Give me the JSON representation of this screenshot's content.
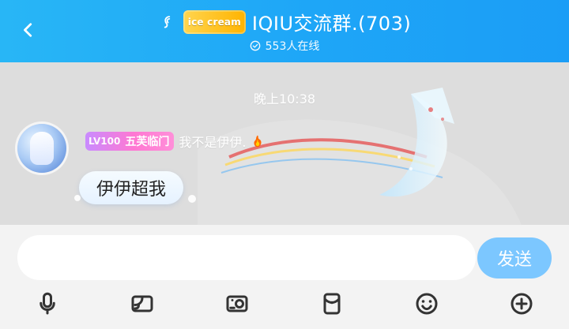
{
  "header": {
    "title": "IQIU交流群.(703)",
    "online_text": "553人在线",
    "group_badge_text": "ice cream",
    "icons": {
      "back": "back-chevron-icon",
      "listen": "ear-icon",
      "online_status": "check-circle-icon"
    },
    "colors": {
      "header_gradient_start": "#28b6f6",
      "header_gradient_end": "#1b9df6"
    }
  },
  "chat": {
    "timestamp": "晚上10:38",
    "messages": [
      {
        "sender_level": "LV100",
        "sender_title": "五芙临门",
        "sender_name": "我不是伊伊.",
        "text": "伊伊超我",
        "icons": {
          "avatar": "avatar-image",
          "sender_badge": "flame-icon"
        }
      }
    ]
  },
  "input": {
    "placeholder": "",
    "send_label": "发送"
  },
  "toolbar": {
    "items": [
      {
        "name": "microphone-icon"
      },
      {
        "name": "screen-cast-icon"
      },
      {
        "name": "photo-icon"
      },
      {
        "name": "red-packet-icon"
      },
      {
        "name": "emoji-icon"
      },
      {
        "name": "plus-icon"
      }
    ]
  }
}
